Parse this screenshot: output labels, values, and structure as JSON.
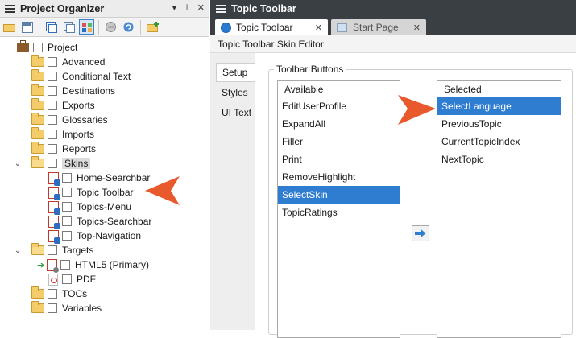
{
  "left_pane": {
    "title": "Project Organizer",
    "controls": {
      "dropdown": "▾",
      "pin": "⊥",
      "close": "✕"
    },
    "tree": {
      "root": "Project",
      "folders": [
        "Advanced",
        "Conditional Text",
        "Destinations",
        "Exports",
        "Glossaries",
        "Imports",
        "Reports"
      ],
      "skins_folder": "Skins",
      "skins": [
        "Home-Searchbar",
        "Topic Toolbar",
        "Topics-Menu",
        "Topics-Searchbar",
        "Top-Navigation"
      ],
      "targets_folder": "Targets",
      "targets": [
        "HTML5 (Primary)",
        "PDF"
      ],
      "bottom_folders": [
        "TOCs",
        "Variables"
      ]
    }
  },
  "right_pane": {
    "title": "Topic Toolbar",
    "tabs": [
      {
        "label": "Topic Toolbar",
        "close": "✕"
      },
      {
        "label": "Start Page",
        "close": "✕"
      }
    ],
    "editor_title": "Topic Toolbar Skin Editor",
    "side_tabs": [
      "Setup",
      "Styles",
      "UI Text"
    ],
    "group_label": "Toolbar Buttons",
    "available": {
      "header": "Available",
      "items": [
        "EditUserProfile",
        "ExpandAll",
        "Filler",
        "Print",
        "RemoveHighlight",
        "SelectSkin",
        "TopicRatings"
      ],
      "selected_item": "SelectSkin"
    },
    "selected": {
      "header": "Selected",
      "items": [
        "SelectLanguage",
        "PreviousTopic",
        "CurrentTopicIndex",
        "NextTopic"
      ],
      "selected_item": "SelectLanguage"
    }
  },
  "colors": {
    "accent": "#2f7dd1",
    "callout": "#e8592b",
    "title_bar": "#3a3f44"
  },
  "icons": [
    "hamburger-icon",
    "folder-icon",
    "skin-icon",
    "checkbox-icon",
    "arrow-right-icon",
    "callout-arrow-icon"
  ]
}
